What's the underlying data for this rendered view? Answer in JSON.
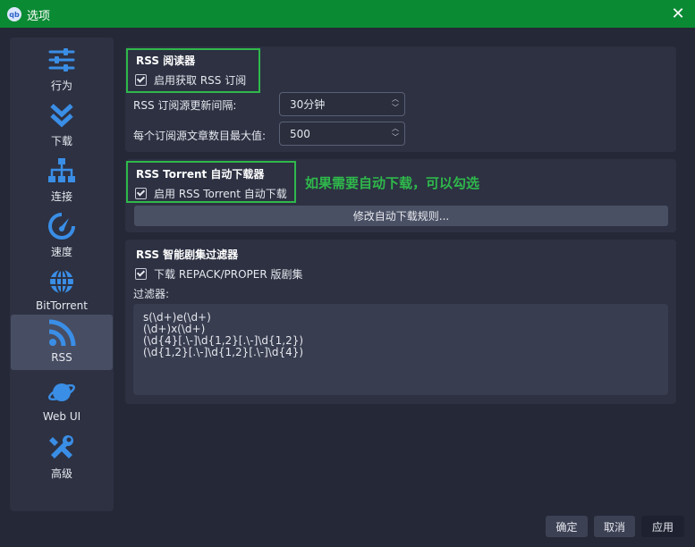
{
  "window": {
    "title": "选项",
    "app_icon_text": "qb",
    "close_glyph": "✕"
  },
  "sidebar": {
    "items": [
      {
        "label": "行为",
        "icon": "sliders-icon"
      },
      {
        "label": "下载",
        "icon": "download-chevron-icon"
      },
      {
        "label": "连接",
        "icon": "network-icon"
      },
      {
        "label": "速度",
        "icon": "speedometer-icon"
      },
      {
        "label": "BitTorrent",
        "icon": "globe-icon"
      },
      {
        "label": "RSS",
        "icon": "rss-icon",
        "active": true
      },
      {
        "label": "Web UI",
        "icon": "planet-icon"
      },
      {
        "label": "高级",
        "icon": "tools-icon"
      }
    ]
  },
  "rss_reader": {
    "title": "RSS 阅读器",
    "enable_fetch_label": "启用获取 RSS 订阅",
    "enable_fetch_checked": true,
    "refresh_interval_label": "RSS 订阅源更新间隔:",
    "refresh_interval_value": "30分钟",
    "max_articles_label": "每个订阅源文章数目最大值:",
    "max_articles_value": "500"
  },
  "auto_downloader": {
    "title": "RSS Torrent 自动下载器",
    "enable_label": "启用 RSS Torrent 自动下载",
    "enable_checked": true,
    "edit_rules_button": "修改自动下载规则...",
    "annotation": "如果需要自动下载，可以勾选"
  },
  "smart_filter": {
    "title": "RSS 智能剧集过滤器",
    "download_repack_label": "下载 REPACK/PROPER 版剧集",
    "download_repack_checked": true,
    "filters_label": "过滤器:",
    "filters": [
      "s(\\d+)e(\\d+)",
      "(\\d+)x(\\d+)",
      "(\\d{4}[.\\-]\\d{1,2}[.\\-]\\d{1,2})",
      "(\\d{1,2}[.\\-]\\d{1,2}[.\\-]\\d{4})"
    ]
  },
  "footer": {
    "ok_label": "确定",
    "cancel_label": "取消",
    "apply_label": "应用"
  },
  "colors": {
    "titlebar": "#0b8a34",
    "highlight": "#2fb84b",
    "accent_icon": "#3a8ee6",
    "background": "#252836",
    "panel": "#2d3142"
  }
}
